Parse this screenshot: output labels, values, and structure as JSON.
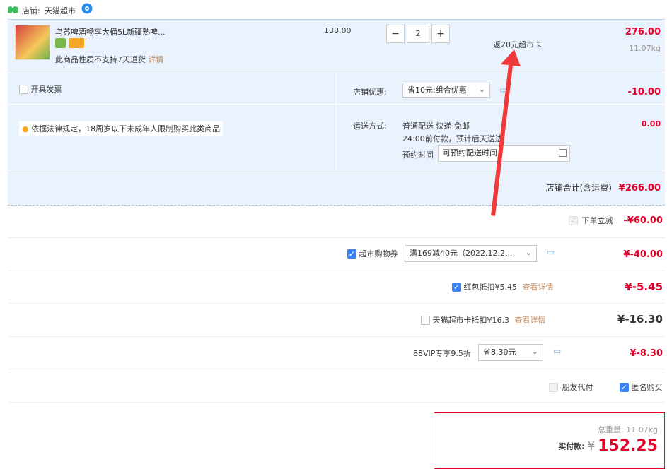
{
  "store": {
    "label": "店铺:",
    "name": "天猫超市"
  },
  "item": {
    "title": "乌苏啤酒畅享大桶5L新疆熟啤...",
    "unit_price": "138.00",
    "quantity": "2",
    "minus": "−",
    "plus": "+",
    "promo": "返20元超市卡",
    "total": "276.00",
    "weight": "11.07kg",
    "return_note": "此商品性质不支持7天退货",
    "return_link": "详情"
  },
  "invoice": {
    "label": "开具发票"
  },
  "store_discount": {
    "label": "店铺优惠:",
    "value": "省10元:组合优惠",
    "amount": "-10.00"
  },
  "legal_notice": "依据法律规定，18周岁以下未成年人限制购买此类商品",
  "shipping": {
    "label": "运送方式:",
    "method": "普通配送 快递 免邮",
    "note": "24:00前付款，预计后天送达",
    "schedule_label": "预约时间",
    "schedule_placeholder": "可预约配送时间",
    "amount": "0.00"
  },
  "store_total": {
    "label": "店铺合计(含运费)",
    "amount": "¥266.00"
  },
  "instant_discount": {
    "label": "下单立减",
    "amount": "-¥60.00"
  },
  "coupon": {
    "label": "超市购物券",
    "value": "满169减40元（2022.12.2...",
    "amount": "¥-40.00"
  },
  "redpacket": {
    "label": "红包抵扣¥5.45",
    "link": "查看详情",
    "amount": "¥-5.45"
  },
  "tmall_card": {
    "label": "天猫超市卡抵扣¥16.3",
    "link": "查看详情",
    "amount": "¥-16.30"
  },
  "vip": {
    "label": "88VIP专享9.5折",
    "value": "省8.30元",
    "amount": "¥-8.30"
  },
  "friend_pay": {
    "label": "朋友代付"
  },
  "anonymous": {
    "label": "匿名购买"
  },
  "summary": {
    "weight_label": "总重量:",
    "weight": "11.07kg",
    "pay_label": "实付款:",
    "currency": "¥",
    "amount": "152.25"
  },
  "colors": {
    "accent_red": "#e4002b",
    "panel_blue": "#eaf3fd",
    "checkbox_blue": "#3b82f6",
    "arrow_red": "#f03a3a"
  },
  "icons": [
    "store-icon",
    "wangwang-chat-icon",
    "tag-icon",
    "card-icon",
    "location-pin-icon",
    "calendar-icon",
    "chat-bubble-icon",
    "chevron-down-icon"
  ]
}
